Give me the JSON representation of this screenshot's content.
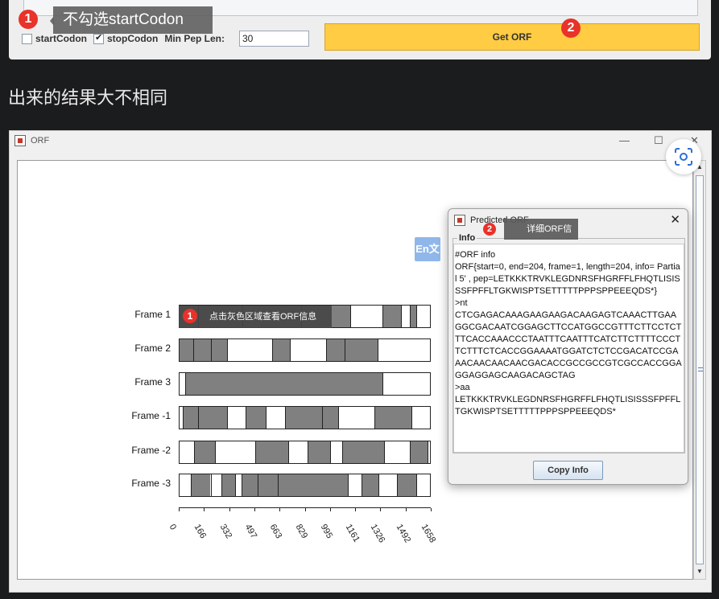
{
  "top": {
    "callout_number": "1",
    "callout_text": "不勾选startCodon",
    "start_codon_label": "startCodon",
    "start_codon_checked": false,
    "stop_codon_label": "stopCodon",
    "stop_codon_checked": true,
    "min_pep_label": "Min Pep Len:",
    "min_pep_value": "30",
    "get_orf_label": "Get ORF",
    "get_orf_badge": "2",
    "accent": "#ffcc43"
  },
  "heading": "出来的结果大不相同",
  "orf_window": {
    "title": "ORF",
    "minimize": "—",
    "maximize": "☐",
    "close": "✕",
    "callout_number": "1",
    "callout_text": "点击灰色区域查看ORF信息",
    "en_icon": "En文",
    "frames": [
      {
        "label": "Frame 1",
        "segments": [
          [
            0,
            0.677
          ],
          [
            0.804,
            0.878
          ],
          [
            0.914,
            0.938
          ]
        ],
        "dividers": [
          0.074,
          0.248,
          0.482,
          0.677,
          0.804,
          0.878,
          0.914,
          0.938
        ]
      },
      {
        "label": "Frame 2",
        "segments": [
          [
            0,
            0.188
          ],
          [
            0.368,
            0.438
          ],
          [
            0.583,
            0.786
          ]
        ],
        "dividers": [
          0.055,
          0.125,
          0.188,
          0.368,
          0.438,
          0.583,
          0.655,
          0.786
        ]
      },
      {
        "label": "Frame 3",
        "segments": [
          [
            0.022,
            0.805
          ]
        ],
        "dividers": [
          0.022,
          0.805
        ]
      },
      {
        "label": "Frame -1",
        "segments": [
          [
            0.013,
            0.19
          ],
          [
            0.262,
            0.342
          ],
          [
            0.42,
            0.63
          ],
          [
            0.774,
            0.92
          ]
        ],
        "dividers": [
          0.013,
          0.074,
          0.19,
          0.262,
          0.342,
          0.42,
          0.566,
          0.63,
          0.774,
          0.92
        ]
      },
      {
        "label": "Frame -2",
        "segments": [
          [
            0.058,
            0.14
          ],
          [
            0.3,
            0.432
          ],
          [
            0.507,
            0.598
          ],
          [
            0.646,
            0.812
          ],
          [
            0.913,
            0.985
          ]
        ],
        "dividers": [
          0.058,
          0.14,
          0.3,
          0.432,
          0.507,
          0.598,
          0.646,
          0.812,
          0.913,
          0.985
        ]
      },
      {
        "label": "Frame -3",
        "segments": [
          [
            0.046,
            0.124
          ],
          [
            0.165,
            0.222
          ],
          [
            0.245,
            0.667
          ],
          [
            0.723,
            0.79
          ],
          [
            0.862,
            0.94
          ]
        ],
        "dividers": [
          0.046,
          0.124,
          0.165,
          0.222,
          0.245,
          0.31,
          0.39,
          0.667,
          0.723,
          0.79,
          0.862,
          0.94
        ]
      }
    ],
    "axis_ticks": [
      "0",
      "166",
      "332",
      "497",
      "663",
      "829",
      "995",
      "1161",
      "1326",
      "1492",
      "1658"
    ],
    "axis_max": 1658
  },
  "dialog": {
    "title": "Predicted ORF",
    "close": "✕",
    "callout_number": "2",
    "callout_text": "详细ORF信息",
    "group_label": "Info",
    "info_text": "#ORF info\nORF{start=0, end=204, frame=1, length=204, info= Partial 5' , pep=LETKKKTRVKLEGDNRSFHGRFFLFHQTLISISSSFPFFLTGKWISPTSETTTTTPPPSPPEEEQDS*}\n>nt\nCTCGAGACAAAGAAGAAGACAAGAGTCAAACTTGAAGGCGACAATCGGAGCTTCCATGGCCGTTTCTTCCTCTTTCACCAAACCCTAATTTCAATTTCATCTTCTTTTCCCTTCTTTCTCACCGGAAAATGGATCTCTCCGACATCCGAAACAACAACAACGACACCGCCGCCGTCGCCACCGGAGGAGGAGCAAGACAGCTAG\n>aa\nLETKKKTRVKLEGDNRSFHGRFFLFHQTLISISSSFPFFLTGKWISPTSETTTTTPPPSPPEEEQDS*",
    "copy_label": "Copy Info"
  }
}
